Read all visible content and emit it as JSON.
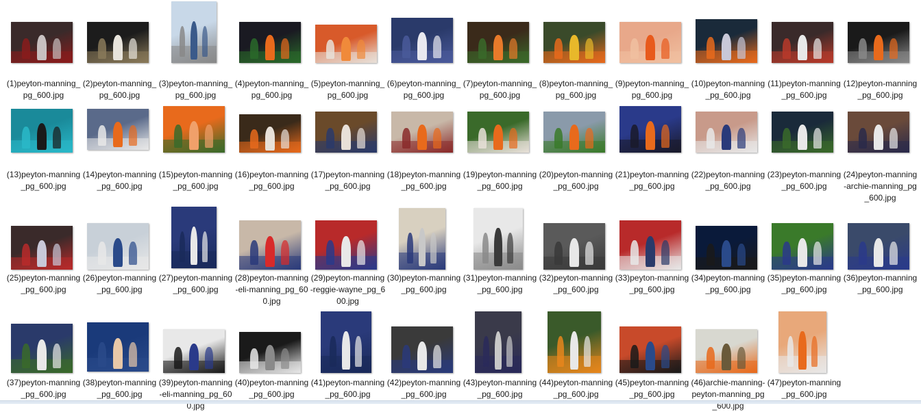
{
  "files": [
    {
      "name": "(1)peyton-manning_pg_600.jpg",
      "palette": [
        "#3a2a2a",
        "#c8c0c0",
        "#8a1c1c"
      ]
    },
    {
      "name": "(2)peyton-manning_pg_600.jpg",
      "palette": [
        "#1c1c1c",
        "#e8e4dc",
        "#8a7a5a"
      ]
    },
    {
      "name": "(3)peyton-manning_pg_600.jpg",
      "palette": [
        "#c8d8e8",
        "#3a5a8a",
        "#888888"
      ]
    },
    {
      "name": "(4)peyton-manning_pg_600.jpg",
      "palette": [
        "#1a1a22",
        "#e86a1c",
        "#2a6a2a"
      ]
    },
    {
      "name": "(5)peyton-manning_pg_600.jpg",
      "palette": [
        "#d85a2a",
        "#f08a3a",
        "#e8e0d8"
      ]
    },
    {
      "name": "(6)peyton-manning_pg_600.jpg",
      "palette": [
        "#2a3a6a",
        "#e8e8f0",
        "#4a5a9a"
      ]
    },
    {
      "name": "(7)peyton-manning_pg_600.jpg",
      "palette": [
        "#3a2a1a",
        "#e87a2a",
        "#3a6a2a"
      ]
    },
    {
      "name": "(8)peyton-manning_pg_600.jpg",
      "palette": [
        "#3a4a2a",
        "#e8b82a",
        "#e86a1c"
      ]
    },
    {
      "name": "(9)peyton-manning_pg_600.jpg",
      "palette": [
        "#e8a88a",
        "#e85a1c",
        "#f0c0a0"
      ]
    },
    {
      "name": "(10)peyton-manning_pg_600.jpg",
      "palette": [
        "#1a2a3a",
        "#c8c8d8",
        "#e86a1c"
      ]
    },
    {
      "name": "(11)peyton-manning_pg_600.jpg",
      "palette": [
        "#3a2a2a",
        "#e8e8e8",
        "#b83a2a"
      ]
    },
    {
      "name": "(12)peyton-manning_pg_600.jpg",
      "palette": [
        "#1a1a1a",
        "#e86a1c",
        "#888888"
      ]
    },
    {
      "name": "(13)peyton-manning_pg_600.jpg",
      "palette": [
        "#1a8a9a",
        "#1a1a1a",
        "#2ab8c8"
      ]
    },
    {
      "name": "(14)peyton-manning_pg_600.jpg",
      "palette": [
        "#5a6a8a",
        "#e86a1c",
        "#e8e8e8"
      ]
    },
    {
      "name": "(15)peyton-manning_pg_600.jpg",
      "palette": [
        "#e86a1c",
        "#f0a06a",
        "#3a6a2a"
      ]
    },
    {
      "name": "(16)peyton-manning_pg_600.jpg",
      "palette": [
        "#3a2a1a",
        "#e8e0d8",
        "#e86a1c"
      ]
    },
    {
      "name": "(17)peyton-manning_pg_600.jpg",
      "palette": [
        "#6a4a2a",
        "#e8e0d8",
        "#2a3a6a"
      ]
    },
    {
      "name": "(18)peyton-manning_pg_600.jpg",
      "palette": [
        "#c8b8a8",
        "#e86a1c",
        "#8a2a2a"
      ]
    },
    {
      "name": "(19)peyton-manning_pg_600.jpg",
      "palette": [
        "#3a6a2a",
        "#e86a1c",
        "#e8e0d8"
      ]
    },
    {
      "name": "(20)peyton-manning_pg_600.jpg",
      "palette": [
        "#8a9aaa",
        "#e86a1c",
        "#3a7a2a"
      ]
    },
    {
      "name": "(21)peyton-manning_pg_600.jpg",
      "palette": [
        "#2a3a8a",
        "#e86a1c",
        "#1a1a2a"
      ]
    },
    {
      "name": "(22)peyton-manning_pg_600.jpg",
      "palette": [
        "#c89a8a",
        "#2a3a7a",
        "#e8e8e8"
      ]
    },
    {
      "name": "(23)peyton-manning_pg_600.jpg",
      "palette": [
        "#1a2a3a",
        "#e8e8e8",
        "#3a6a2a"
      ]
    },
    {
      "name": "(24)peyton-manning-archie-manning_pg_600.jpg",
      "palette": [
        "#6a4a3a",
        "#e8e8e8",
        "#2a2a4a"
      ]
    },
    {
      "name": "(25)peyton-manning_pg_600.jpg",
      "palette": [
        "#3a2a2a",
        "#c8c8d8",
        "#b82a2a"
      ]
    },
    {
      "name": "(26)peyton-manning_pg_600.jpg",
      "palette": [
        "#c8d0d8",
        "#2a4a8a",
        "#e8e8e8"
      ]
    },
    {
      "name": "(27)peyton-manning_pg_600.jpg",
      "palette": [
        "#2a3a7a",
        "#e8e8e8",
        "#1a2a5a"
      ]
    },
    {
      "name": "(28)peyton-manning-eli-manning_pg_600.jpg",
      "palette": [
        "#c8b8a8",
        "#d82a2a",
        "#2a3a7a"
      ]
    },
    {
      "name": "(29)peyton-manning-reggie-wayne_pg_600.jpg",
      "palette": [
        "#b82a2a",
        "#e8e8e8",
        "#2a3a8a"
      ]
    },
    {
      "name": "(30)peyton-manning_pg_600.jpg",
      "palette": [
        "#d8d0c0",
        "#c8c8c8",
        "#2a3a7a"
      ]
    },
    {
      "name": "(31)peyton-manning_pg_600.jpg",
      "palette": [
        "#e8e8e8",
        "#3a3a3a",
        "#8a8a8a"
      ]
    },
    {
      "name": "(32)peyton-manning_pg_600.jpg",
      "palette": [
        "#5a5a5a",
        "#e8e8e8",
        "#3a3a3a"
      ]
    },
    {
      "name": "(33)peyton-manning_pg_600.jpg",
      "palette": [
        "#b82a2a",
        "#2a3a6a",
        "#e8e8e8"
      ]
    },
    {
      "name": "(34)peyton-manning_pg_600.jpg",
      "palette": [
        "#0a1a3a",
        "#2a4a8a",
        "#1a1a1a"
      ]
    },
    {
      "name": "(35)peyton-manning_pg_600.jpg",
      "palette": [
        "#3a7a2a",
        "#e8e8e8",
        "#2a3a8a"
      ]
    },
    {
      "name": "(36)peyton-manning_pg_600.jpg",
      "palette": [
        "#3a4a6a",
        "#e8e8e8",
        "#2a3a8a"
      ]
    },
    {
      "name": "(37)peyton-manning_pg_600.jpg",
      "palette": [
        "#2a3a6a",
        "#e8e8e8",
        "#3a6a2a"
      ]
    },
    {
      "name": "(38)peyton-manning_pg_600.jpg",
      "palette": [
        "#1a3a7a",
        "#e8c8a8",
        "#2a4a8a"
      ]
    },
    {
      "name": "(39)peyton-manning-eli-manning_pg_600.jpg",
      "palette": [
        "#e8e8e8",
        "#2a3a8a",
        "#1a1a1a"
      ]
    },
    {
      "name": "(40)peyton-manning_pg_600.jpg",
      "palette": [
        "#1a1a1a",
        "#8a8a8a",
        "#e8e8e8"
      ]
    },
    {
      "name": "(41)peyton-manning_pg_600.jpg",
      "palette": [
        "#2a3a7a",
        "#e8e8e8",
        "#1a2a5a"
      ]
    },
    {
      "name": "(42)peyton-manning_pg_600.jpg",
      "palette": [
        "#3a3a3a",
        "#e8e8e8",
        "#2a3a7a"
      ]
    },
    {
      "name": "(43)peyton-manning_pg_600.jpg",
      "palette": [
        "#3a3a4a",
        "#c8c8c8",
        "#2a2a5a"
      ]
    },
    {
      "name": "(44)peyton-manning_pg_600.jpg",
      "palette": [
        "#3a5a2a",
        "#e8e8e8",
        "#e8861c"
      ]
    },
    {
      "name": "(45)peyton-manning_pg_600.jpg",
      "palette": [
        "#c84a2a",
        "#2a4a8a",
        "#1a1a1a"
      ]
    },
    {
      "name": "(46)archie-manning-peyton-manning_pg_600.jpg",
      "palette": [
        "#d8d8d0",
        "#6a5a3a",
        "#e86a1c"
      ]
    },
    {
      "name": "(47)peyton-manning_pg_600.jpg",
      "palette": [
        "#e8a87a",
        "#e86a1c",
        "#e8e8e8"
      ]
    }
  ]
}
